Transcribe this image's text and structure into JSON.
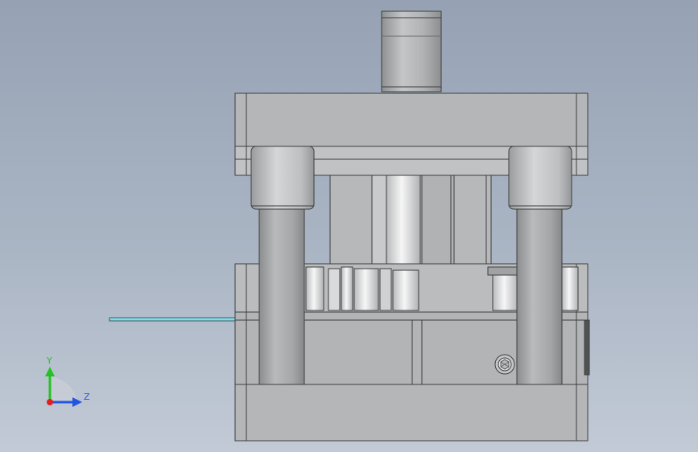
{
  "viewport": {
    "title": "",
    "background_top": "#96a2b4",
    "background_bottom": "#c2cad6"
  },
  "model": {
    "name": "",
    "view": "front"
  },
  "triad": {
    "y_label": "Y",
    "z_label": "Z",
    "y_color": "#22c322",
    "z_color": "#2255e0",
    "x_color": "#e02020"
  },
  "colors": {
    "plate": "#b4b6b8",
    "plate_dark": "#9fa1a4",
    "edge": "#3e3e3e",
    "guide_post": "#a6a8aa",
    "bushing": "#c6c8ca",
    "punch_highlight": "#eeeeee",
    "strip": "#7fdcec"
  }
}
